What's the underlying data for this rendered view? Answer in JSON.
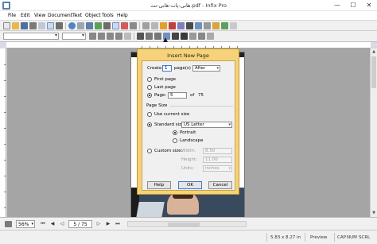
{
  "window": {
    "title": "هانی-پات-هانی-نت.pdf - Infix Pro",
    "minimize": "—",
    "maximize": "☐",
    "close": "✕"
  },
  "menu": {
    "items": [
      "File",
      "Edit",
      "View",
      "Document",
      "Text",
      "Object",
      "Tools",
      "Help"
    ]
  },
  "dialog": {
    "title": "Insert New Page",
    "create_label": "Create",
    "create_count": "1",
    "pages_label": "page(s)",
    "position_value": "After",
    "first_page": "First page",
    "last_page": "Last page",
    "page_label": "Page:",
    "page_value": "5",
    "of_label": "of",
    "total_pages": "75",
    "page_size_title": "Page Size",
    "use_current_size": "Use current size",
    "standard_size": "Standard size:",
    "standard_value": "US Letter",
    "portrait": "Portrait",
    "landscape": "Landscape",
    "custom_size": "Custom size:",
    "width_label": "Width:",
    "width_value": "8.50",
    "height_label": "Height:",
    "height_value": "11.00",
    "units_label": "Units:",
    "units_value": "inches",
    "help_button": "Help",
    "ok_button": "OK",
    "cancel_button": "Cancel"
  },
  "navbar": {
    "zoom": "56%",
    "page_indicator": "5 / 75"
  },
  "status": {
    "dimensions": "5.83 x 8.27 in",
    "mode": "Preview",
    "caps": "CAP",
    "num": "NUM",
    "scrl": "SCRL"
  },
  "icons": {
    "app": "infix-app-icon",
    "colors": {
      "dialog_frame": "#f6d27a",
      "canvas": "#a5a5a5"
    }
  }
}
